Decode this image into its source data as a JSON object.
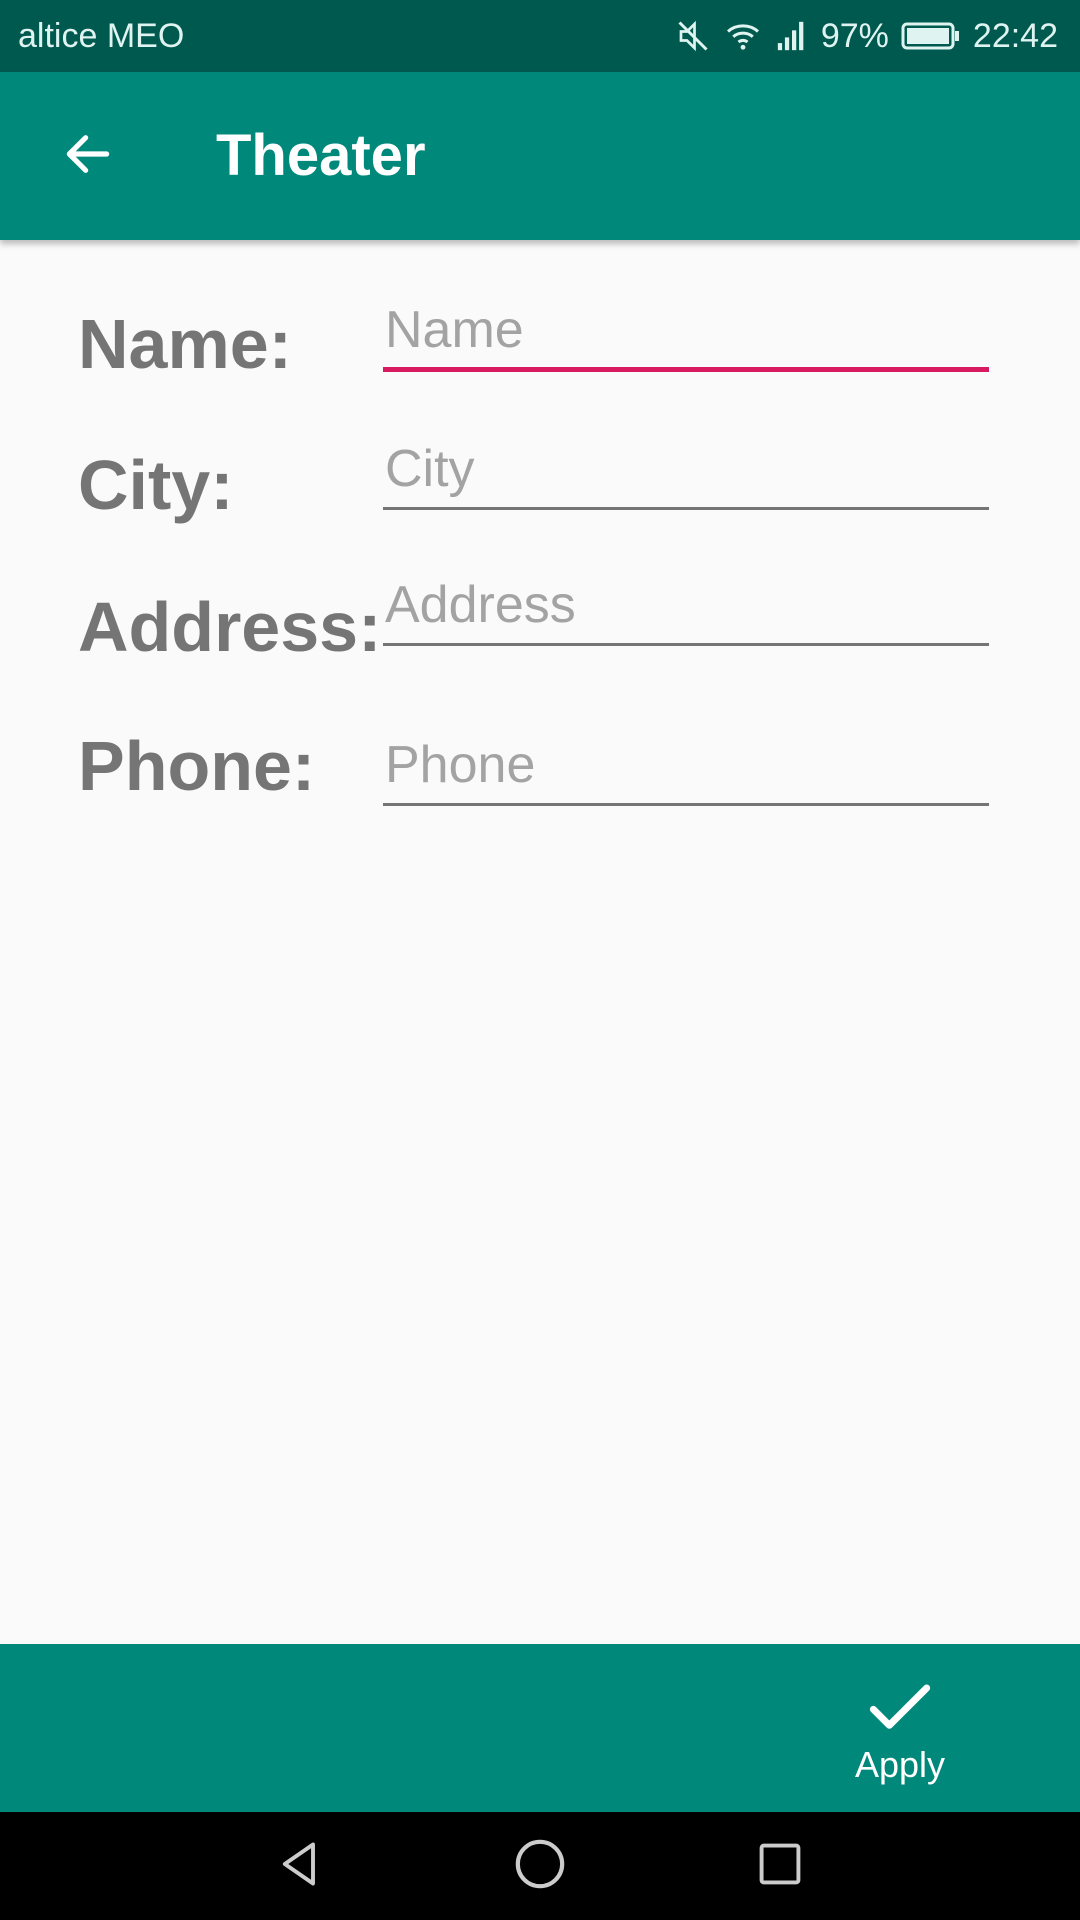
{
  "status_bar": {
    "carrier": "altice MEO",
    "battery": "97%",
    "time": "22:42",
    "icons": [
      "mute-icon",
      "wifi-icon",
      "signal-icon",
      "battery-icon"
    ]
  },
  "app_bar": {
    "title": "Theater",
    "back_icon": "arrow-back-icon"
  },
  "form": {
    "fields": [
      {
        "label": "Name:",
        "placeholder": "Name",
        "value": "",
        "focused": true
      },
      {
        "label": "City:",
        "placeholder": "City",
        "value": "",
        "focused": false
      },
      {
        "label": "Address:",
        "placeholder": "Address",
        "value": "",
        "focused": false
      },
      {
        "label": "Phone:",
        "placeholder": "Phone",
        "value": "",
        "focused": false
      }
    ]
  },
  "bottom_bar": {
    "apply_label": "Apply",
    "apply_icon": "check-icon"
  },
  "nav_bar": {
    "icons": [
      "back-triangle-icon",
      "home-circle-icon",
      "recents-square-icon"
    ]
  },
  "colors": {
    "status_bar": "#00594f",
    "primary": "#00897b",
    "accent": "#d81b60",
    "label": "#757575",
    "placeholder": "#a3a3a3",
    "background": "#fafafa"
  }
}
